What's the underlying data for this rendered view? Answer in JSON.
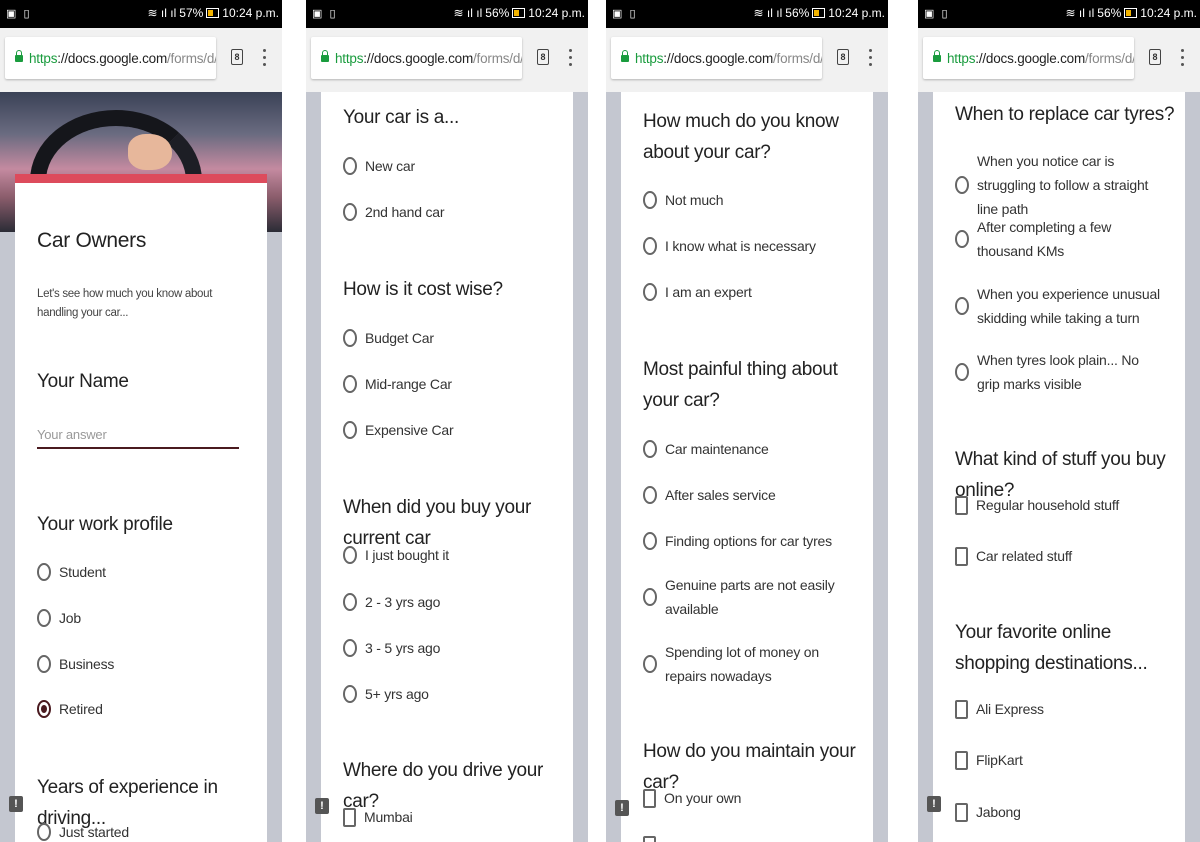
{
  "status": {
    "icons": "image-icon sim-icon",
    "signal": "wifi + cellular",
    "panels": [
      {
        "battery": "57%",
        "time": "10:24 p.m."
      },
      {
        "battery": "56%",
        "time": "10:24 p.m."
      },
      {
        "battery": "56%",
        "time": "10:24 p.m."
      },
      {
        "battery": "56%",
        "time": "10:24 p.m."
      }
    ]
  },
  "browser": {
    "url_proto": "https",
    "url_host": "://docs.google.com",
    "url_path": "/forms/d/e/",
    "tab_count": "8"
  },
  "panel1": {
    "form_title": "Car Owners",
    "form_description": "Let's see how much you know about handling your car...",
    "q_name": "Your Name",
    "name_placeholder": "Your answer",
    "q_work": "Your work profile",
    "work_options": [
      "Student",
      "Job",
      "Business",
      "Retired"
    ],
    "work_selected": "Retired",
    "q_years": "Years of experience in driving...",
    "years_first_option": "Just started"
  },
  "panel2": {
    "q_car": "Your car is a...",
    "car_options": [
      "New car",
      "2nd hand car"
    ],
    "q_cost": "How is it cost wise?",
    "cost_options": [
      "Budget Car",
      "Mid-range Car",
      "Expensive Car"
    ],
    "q_bought": "When did you buy your current car",
    "bought_options": [
      "I just bought it",
      "2 - 3 yrs ago",
      "3 - 5 yrs ago",
      "5+ yrs ago"
    ],
    "q_drive": "Where do you drive your car?",
    "drive_options": [
      "Mumbai"
    ]
  },
  "panel3": {
    "q_know": "How much do you know about your car?",
    "know_options": [
      "Not much",
      "I know what is necessary",
      "I am an expert"
    ],
    "q_pain": "Most painful thing about your car?",
    "pain_options": [
      "Car maintenance",
      "After sales service",
      "Finding options for car tyres",
      "Genuine parts are not easily available",
      "Spending lot of money on repairs nowadays"
    ],
    "q_maintain": "How do you maintain your car?",
    "maintain_options": [
      "On your own"
    ]
  },
  "panel4": {
    "q_tyres": "When to replace car tyres?",
    "tyre_options": [
      "When you notice car is struggling to follow a straight line path",
      "After completing a few thousand KMs",
      "When you experience unusual skidding while taking a turn",
      "When tyres look plain... No grip marks visible"
    ],
    "q_stuff": "What kind of stuff you buy online?",
    "stuff_options": [
      "Regular household stuff",
      "Car related stuff"
    ],
    "q_shop": "Your favorite online shopping destinations...",
    "shop_options": [
      "Ali Express",
      "FlipKart",
      "Jabong"
    ]
  },
  "colors": {
    "accent": "#dd4b5c",
    "selected_radio": "#4a1a1f",
    "secure_green": "#1a9c3e",
    "background": "#c4c7d0"
  }
}
